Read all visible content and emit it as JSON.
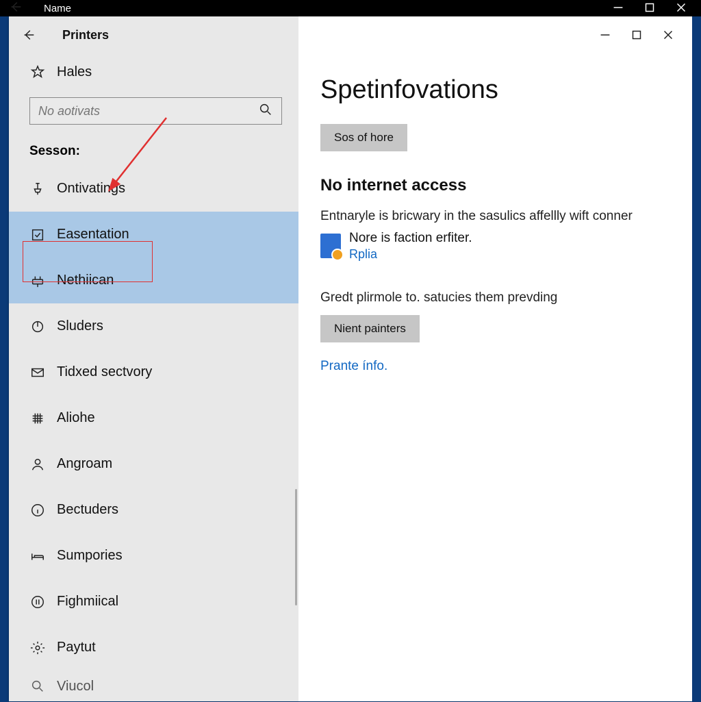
{
  "outer": {
    "title": "Name"
  },
  "window": {
    "title": "Printers"
  },
  "sidebar": {
    "home_label": "Hales",
    "search_placeholder": "No aotivats",
    "section_label": "Sesson:",
    "items": [
      {
        "label": "Ontivatings",
        "icon": "pin-icon"
      },
      {
        "label": "Easentation",
        "icon": "checkbox-icon",
        "selected": true,
        "highlighted": true
      },
      {
        "label": "Nethiican",
        "icon": "router-icon",
        "selected": true
      },
      {
        "label": "Sluders",
        "icon": "power-icon"
      },
      {
        "label": "Tidxed sectvory",
        "icon": "mail-icon"
      },
      {
        "label": "Aliohe",
        "icon": "grid-icon"
      },
      {
        "label": "Angroam",
        "icon": "person-icon"
      },
      {
        "label": "Bectuders",
        "icon": "info-icon"
      },
      {
        "label": "Sumpories",
        "icon": "bed-icon"
      },
      {
        "label": "Fighmiical",
        "icon": "pause-circle-icon"
      },
      {
        "label": "Paytut",
        "icon": "gear-icon"
      },
      {
        "label": "Viucol",
        "icon": "search-icon"
      }
    ]
  },
  "main": {
    "page_title": "Spetinfovations",
    "button1": "Sos of hore",
    "h2": "No internet access",
    "body_line": "Entnaryle is bricwary in the sasulics affellly wift conner",
    "device_line1": "Nore is faction erfiter.",
    "device_link": "Rplia",
    "body_line2": "Gredt plirmole to. satucies them prevding",
    "button2": "Nient painters",
    "link": "Prante ínfo."
  }
}
